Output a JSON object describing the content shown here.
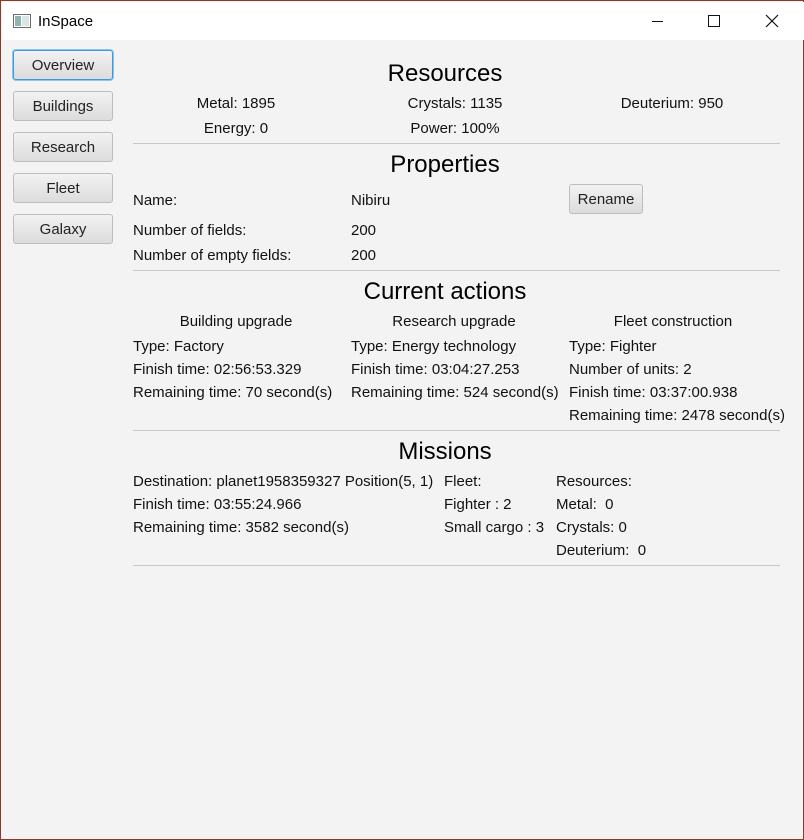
{
  "window": {
    "title": "InSpace"
  },
  "sidebar": {
    "items": [
      {
        "label": "Overview"
      },
      {
        "label": "Buildings"
      },
      {
        "label": "Research"
      },
      {
        "label": "Fleet"
      },
      {
        "label": "Galaxy"
      }
    ]
  },
  "resources": {
    "heading": "Resources",
    "metal": "Metal: 1895",
    "crystals": "Crystals: 1135",
    "deuterium": "Deuterium: 950",
    "energy": "Energy: 0",
    "power": "Power: 100%"
  },
  "properties": {
    "heading": "Properties",
    "name_label": "Name:",
    "name_value": "Nibiru",
    "rename_label": "Rename",
    "fields_label": "Number of fields:",
    "fields_value": "200",
    "empty_fields_label": "Number of empty fields:",
    "empty_fields_value": "200"
  },
  "actions": {
    "heading": "Current actions",
    "building": {
      "title": "Building upgrade",
      "type": "Type: Factory",
      "finish": "Finish time: 02:56:53.329",
      "remaining": "Remaining time: 70 second(s)"
    },
    "research": {
      "title": "Research upgrade",
      "type": "Type: Energy technology",
      "finish": "Finish time: 03:04:27.253",
      "remaining": "Remaining time: 524 second(s)"
    },
    "fleet": {
      "title": "Fleet construction",
      "type": "Type: Fighter",
      "units": "Number of units: 2",
      "finish": "Finish time: 03:37:00.938",
      "remaining": "Remaining time: 2478 second(s)"
    }
  },
  "missions": {
    "heading": "Missions",
    "destination": "Destination: planet1958359327 Position(5, 1)",
    "finish": "Finish time: 03:55:24.966",
    "remaining": "Remaining time: 3582 second(s)",
    "fleet_label": "Fleet:",
    "fleet_items": [
      "Fighter : 2",
      "Small cargo : 3"
    ],
    "resources_label": "Resources:",
    "resource_items": [
      "Metal:  0",
      "Crystals: 0",
      "Deuterium:  0"
    ]
  }
}
